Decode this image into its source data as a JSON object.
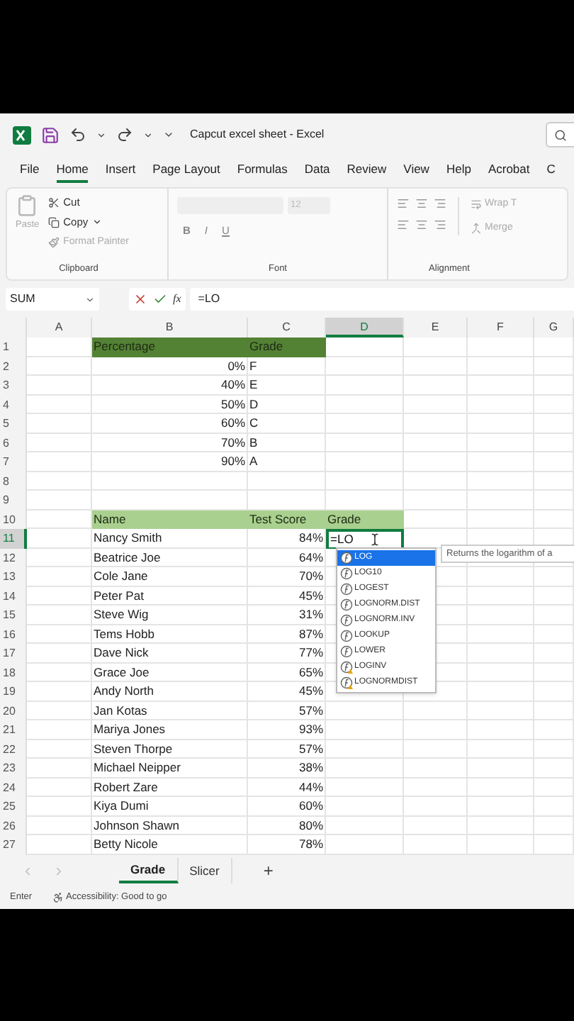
{
  "title_bar": {
    "title": "Capcut excel sheet  -  Excel"
  },
  "ribbon_tabs": [
    {
      "label": "File",
      "selected": false
    },
    {
      "label": "Home",
      "selected": true
    },
    {
      "label": "Insert",
      "selected": false
    },
    {
      "label": "Page Layout",
      "selected": false
    },
    {
      "label": "Formulas",
      "selected": false
    },
    {
      "label": "Data",
      "selected": false
    },
    {
      "label": "Review",
      "selected": false
    },
    {
      "label": "View",
      "selected": false
    },
    {
      "label": "Help",
      "selected": false
    },
    {
      "label": "Acrobat",
      "selected": false
    },
    {
      "label": "C",
      "selected": false
    }
  ],
  "ribbon": {
    "clipboard": {
      "paste": "Paste",
      "cut": "Cut",
      "copy": "Copy",
      "format_painter": "Format Painter",
      "label": "Clipboard"
    },
    "font": {
      "size": "12",
      "bold": "B",
      "italic": "I",
      "underline": "U",
      "label": "Font"
    },
    "alignment": {
      "wrap": "Wrap T",
      "merge": "Merge",
      "label": "Alignment"
    }
  },
  "formula_bar": {
    "name_box": "SUM",
    "function_label": "fx",
    "formula": "=LO"
  },
  "columns": [
    {
      "label": "A",
      "selected": false
    },
    {
      "label": "B",
      "selected": false
    },
    {
      "label": "C",
      "selected": false
    },
    {
      "label": "D",
      "selected": true
    },
    {
      "label": "E",
      "selected": false
    },
    {
      "label": "F",
      "selected": false
    },
    {
      "label": "G",
      "selected": false
    }
  ],
  "rows": [
    {
      "number": "1",
      "selected": false,
      "kind": "heading",
      "color": "#548235",
      "column_b": {
        "text": "Percentage",
        "kind": "text"
      },
      "column_c": {
        "text": "Grade",
        "kind": "text"
      }
    },
    {
      "number": "2",
      "selected": false,
      "kind": "plain",
      "column_b": {
        "text": "0%",
        "kind": "number"
      },
      "column_c": {
        "text": "F",
        "kind": "text"
      }
    },
    {
      "number": "3",
      "selected": false,
      "kind": "plain",
      "column_b": {
        "text": "40%",
        "kind": "number"
      },
      "column_c": {
        "text": "E",
        "kind": "text"
      }
    },
    {
      "number": "4",
      "selected": false,
      "kind": "plain",
      "column_b": {
        "text": "50%",
        "kind": "number"
      },
      "column_c": {
        "text": "D",
        "kind": "text"
      }
    },
    {
      "number": "5",
      "selected": false,
      "kind": "plain",
      "column_b": {
        "text": "60%",
        "kind": "number"
      },
      "column_c": {
        "text": "C",
        "kind": "text"
      }
    },
    {
      "number": "6",
      "selected": false,
      "kind": "plain",
      "column_b": {
        "text": "70%",
        "kind": "number"
      },
      "column_c": {
        "text": "B",
        "kind": "text"
      }
    },
    {
      "number": "7",
      "selected": false,
      "kind": "plain",
      "column_b": {
        "text": "90%",
        "kind": "number"
      },
      "column_c": {
        "text": "A",
        "kind": "text"
      }
    },
    {
      "number": "8",
      "selected": false
    },
    {
      "number": "9",
      "selected": false
    },
    {
      "number": "10",
      "selected": false,
      "kind": "heading",
      "color": "#a9d08e",
      "column_b": {
        "text": "Name",
        "kind": "text"
      },
      "column_c": {
        "text": "Test Score",
        "kind": "text"
      },
      "column_d": {
        "text": "Grade",
        "kind": "text"
      }
    },
    {
      "number": "11",
      "selected": true,
      "kind": "plain",
      "column_b": {
        "text": "Nancy Smith",
        "kind": "text"
      },
      "column_c": {
        "text": "84%",
        "kind": "number"
      },
      "column_d": {
        "text": "=LO",
        "kind": "editing"
      }
    },
    {
      "number": "12",
      "selected": false,
      "kind": "plain",
      "column_b": {
        "text": "Beatrice Joe",
        "kind": "text"
      },
      "column_c": {
        "text": "64%",
        "kind": "number"
      }
    },
    {
      "number": "13",
      "selected": false,
      "kind": "plain",
      "column_b": {
        "text": "Cole Jane",
        "kind": "text"
      },
      "column_c": {
        "text": "70%",
        "kind": "number"
      }
    },
    {
      "number": "14",
      "selected": false,
      "kind": "plain",
      "column_b": {
        "text": "Peter Pat",
        "kind": "text"
      },
      "column_c": {
        "text": "45%",
        "kind": "number"
      }
    },
    {
      "number": "15",
      "selected": false,
      "kind": "plain",
      "column_b": {
        "text": "Steve Wig",
        "kind": "text"
      },
      "column_c": {
        "text": "31%",
        "kind": "number"
      }
    },
    {
      "number": "16",
      "selected": false,
      "kind": "plain",
      "column_b": {
        "text": "Tems Hobb",
        "kind": "text"
      },
      "column_c": {
        "text": "87%",
        "kind": "number"
      }
    },
    {
      "number": "17",
      "selected": false,
      "kind": "plain",
      "column_b": {
        "text": "Dave Nick",
        "kind": "text"
      },
      "column_c": {
        "text": "77%",
        "kind": "number"
      }
    },
    {
      "number": "18",
      "selected": false,
      "kind": "plain",
      "column_b": {
        "text": "Grace Joe",
        "kind": "text"
      },
      "column_c": {
        "text": "65%",
        "kind": "number"
      }
    },
    {
      "number": "19",
      "selected": false,
      "kind": "plain",
      "column_b": {
        "text": "Andy North",
        "kind": "text"
      },
      "column_c": {
        "text": "45%",
        "kind": "number"
      }
    },
    {
      "number": "20",
      "selected": false,
      "kind": "plain",
      "column_b": {
        "text": "Jan Kotas",
        "kind": "text"
      },
      "column_c": {
        "text": "57%",
        "kind": "number"
      }
    },
    {
      "number": "21",
      "selected": false,
      "kind": "plain",
      "column_b": {
        "text": "Mariya Jones",
        "kind": "text"
      },
      "column_c": {
        "text": "93%",
        "kind": "number"
      }
    },
    {
      "number": "22",
      "selected": false,
      "kind": "plain",
      "column_b": {
        "text": "Steven Thorpe",
        "kind": "text"
      },
      "column_c": {
        "text": "57%",
        "kind": "number"
      }
    },
    {
      "number": "23",
      "selected": false,
      "kind": "plain",
      "column_b": {
        "text": "Michael Neipper",
        "kind": "text"
      },
      "column_c": {
        "text": "38%",
        "kind": "number"
      }
    },
    {
      "number": "24",
      "selected": false,
      "kind": "plain",
      "column_b": {
        "text": "Robert Zare",
        "kind": "text"
      },
      "column_c": {
        "text": "44%",
        "kind": "number"
      }
    },
    {
      "number": "25",
      "selected": false,
      "kind": "plain",
      "column_b": {
        "text": "Kiya Dumi",
        "kind": "text"
      },
      "column_c": {
        "text": "60%",
        "kind": "number"
      }
    },
    {
      "number": "26",
      "selected": false,
      "kind": "plain",
      "column_b": {
        "text": "Johnson  Shawn",
        "kind": "text"
      },
      "column_c": {
        "text": "80%",
        "kind": "number"
      }
    },
    {
      "number": "27",
      "selected": false,
      "kind": "plain",
      "column_b": {
        "text": "Betty Nicole",
        "kind": "text"
      },
      "column_c": {
        "text": "78%",
        "kind": "number"
      }
    }
  ],
  "autocomplete": {
    "items": [
      {
        "label": "LOG",
        "selected": true,
        "kind": "function"
      },
      {
        "label": "LOG10",
        "selected": false,
        "kind": "function"
      },
      {
        "label": "LOGEST",
        "selected": false,
        "kind": "function"
      },
      {
        "label": "LOGNORM.DIST",
        "selected": false,
        "kind": "function"
      },
      {
        "label": "LOGNORM.INV",
        "selected": false,
        "kind": "function"
      },
      {
        "label": "LOOKUP",
        "selected": false,
        "kind": "function"
      },
      {
        "label": "LOWER",
        "selected": false,
        "kind": "function"
      },
      {
        "label": "LOGINV",
        "selected": false,
        "kind": "compatibility"
      },
      {
        "label": "LOGNORMDIST",
        "selected": false,
        "kind": "compatibility"
      }
    ],
    "tooltip": "Returns the logarithm of a"
  },
  "sheet_tabs": [
    {
      "label": "Grade",
      "selected": true
    },
    {
      "label": "Slicer",
      "selected": false
    }
  ],
  "add_sheet": "+",
  "status_bar": {
    "mode": "Enter",
    "accessibility": "Accessibility: Good to go"
  }
}
